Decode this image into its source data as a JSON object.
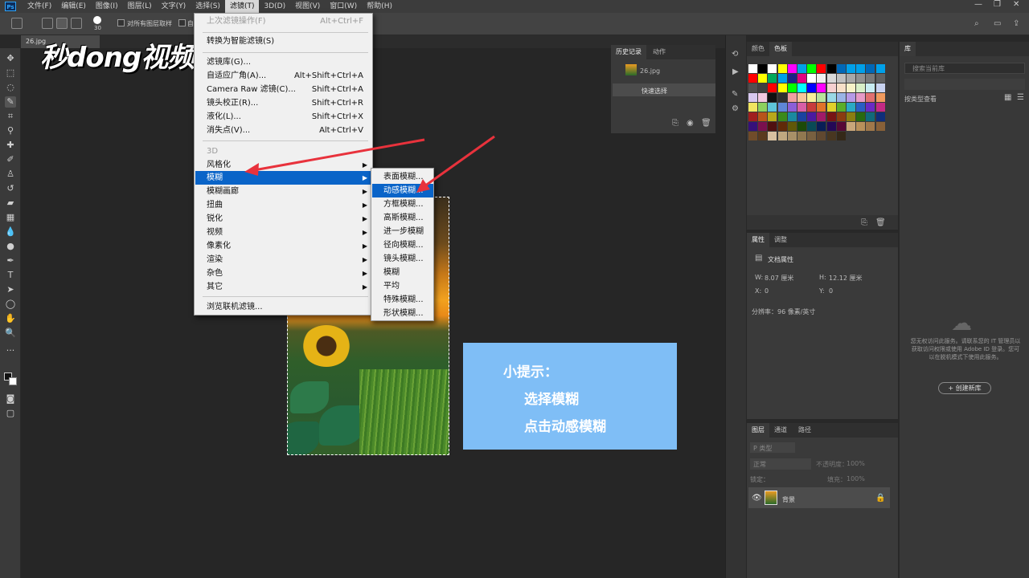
{
  "menubar": {
    "items": [
      "文件(F)",
      "编辑(E)",
      "图像(I)",
      "图层(L)",
      "文字(Y)",
      "选择(S)",
      "滤镜(T)",
      "3D(D)",
      "视图(V)",
      "窗口(W)",
      "帮助(H)"
    ],
    "active_index": 6,
    "ps_logo": "Ps",
    "window_controls": [
      "—",
      "❐",
      "✕"
    ]
  },
  "options": {
    "brush_size": "30",
    "sample_all_layers": "对所有图层取样",
    "auto_enhance": "自"
  },
  "document": {
    "tab_label": "26.jpg"
  },
  "watermark": "秒dong视频",
  "filter_menu": {
    "items": [
      {
        "label": "上次滤镜操作(F)",
        "shortcut": "Alt+Ctrl+F",
        "disabled": true
      },
      {
        "label": "转换为智能滤镜(S)",
        "shortcut": ""
      },
      {
        "label": "滤镜库(G)...",
        "shortcut": ""
      },
      {
        "label": "自适应广角(A)...",
        "shortcut": "Alt+Shift+Ctrl+A"
      },
      {
        "label": "Camera Raw 滤镜(C)...",
        "shortcut": "Shift+Ctrl+A"
      },
      {
        "label": "镜头校正(R)...",
        "shortcut": "Shift+Ctrl+R"
      },
      {
        "label": "液化(L)...",
        "shortcut": "Shift+Ctrl+X"
      },
      {
        "label": "消失点(V)...",
        "shortcut": "Alt+Ctrl+V"
      },
      {
        "label": "3D",
        "shortcut": "",
        "disabled": true
      },
      {
        "label": "风格化",
        "submenu": true
      },
      {
        "label": "模糊",
        "submenu": true,
        "highlighted": true
      },
      {
        "label": "模糊画廊",
        "submenu": true
      },
      {
        "label": "扭曲",
        "submenu": true
      },
      {
        "label": "锐化",
        "submenu": true
      },
      {
        "label": "视频",
        "submenu": true
      },
      {
        "label": "像素化",
        "submenu": true
      },
      {
        "label": "渲染",
        "submenu": true
      },
      {
        "label": "杂色",
        "submenu": true
      },
      {
        "label": "其它",
        "submenu": true
      },
      {
        "label": "浏览联机滤镜...",
        "shortcut": ""
      }
    ]
  },
  "blur_submenu": {
    "items": [
      "表面模糊...",
      "动感模糊...",
      "方框模糊...",
      "高斯模糊...",
      "进一步模糊",
      "径向模糊...",
      "镜头模糊...",
      "模糊",
      "平均",
      "特殊模糊...",
      "形状模糊..."
    ],
    "highlighted_index": 1
  },
  "tip": {
    "title": "小提示：",
    "line1": "选择模糊",
    "line2": "点击动感模糊"
  },
  "history_panel": {
    "tabs": [
      "历史记录",
      "动作"
    ],
    "snapshot": "26.jpg",
    "step": "快速选择"
  },
  "swatches_panel": {
    "tabs": [
      "颜色",
      "色板"
    ]
  },
  "properties_panel": {
    "tabs": [
      "属性",
      "调整"
    ],
    "title": "文档属性",
    "w_label": "W:",
    "w_value": "8.07 厘米",
    "h_label": "H:",
    "h_value": "12.12 厘米",
    "x_label": "X:",
    "x_value": "0",
    "y_label": "Y:",
    "y_value": "0",
    "resolution": "分辨率：96 像素/英寸"
  },
  "library_panel": {
    "tab": "库",
    "search_placeholder": "搜索当前库",
    "view_by": "按类型查看",
    "message": "您无权访问此服务。请联系您的 IT 管理员以获取访问权限或使用 Adobe ID 登录。您可以在脱机模式下使用此服务。",
    "create_button": "+ 创建新库"
  },
  "layers_panel": {
    "tabs": [
      "图层",
      "通道",
      "路径"
    ],
    "kind": "P 类型",
    "blend_mode": "正常",
    "opacity_label": "不透明度：",
    "opacity": "100%",
    "lock_label": "锁定：",
    "fill_label": "填充：",
    "fill": "100%",
    "layer_name": "背景"
  },
  "colors": {
    "menu_highlight": "#0a64c8",
    "tip_bg": "#7fbef6",
    "arrow": "#e8323c"
  }
}
